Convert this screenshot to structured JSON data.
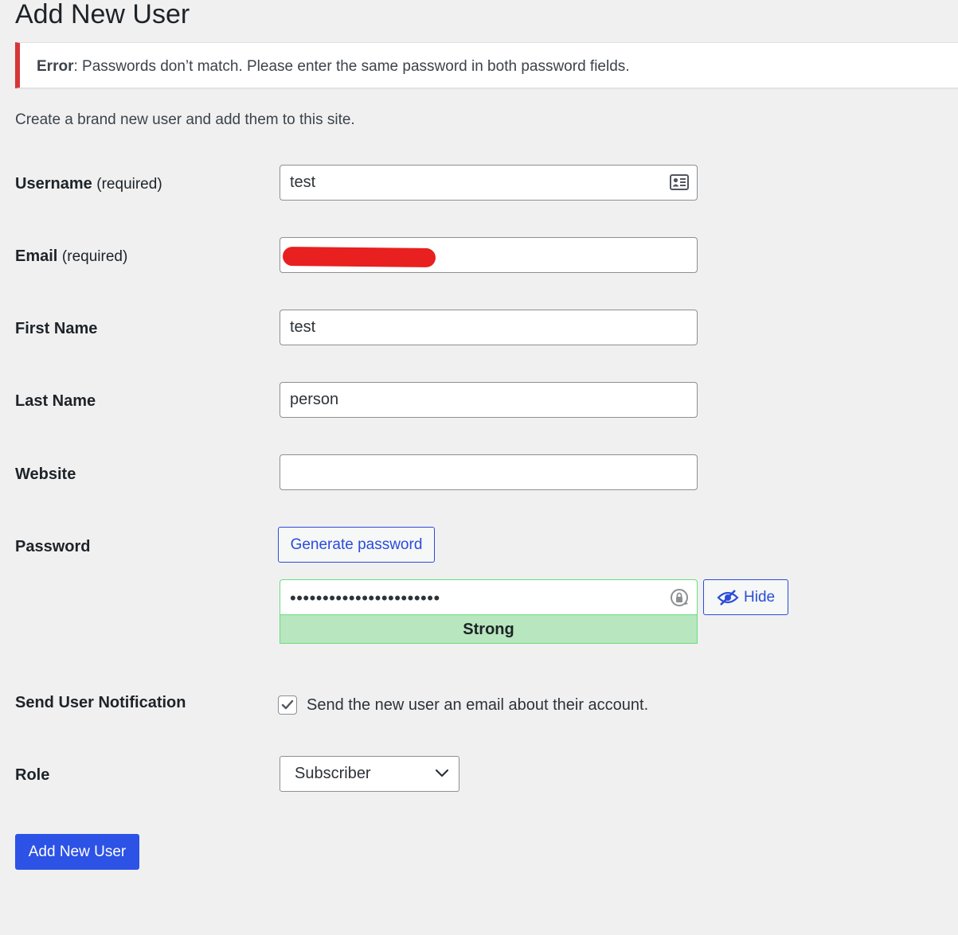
{
  "page": {
    "title": "Add New User",
    "intro": "Create a brand new user and add them to this site."
  },
  "notice": {
    "label": "Error",
    "message": ": Passwords don’t match. Please enter the same password in both password fields."
  },
  "fields": {
    "username": {
      "label": "Username",
      "required": "(required)",
      "value": "test"
    },
    "email": {
      "label": "Email",
      "required": "(required)",
      "value": ""
    },
    "first_name": {
      "label": "First Name",
      "value": "test"
    },
    "last_name": {
      "label": "Last Name",
      "value": "person"
    },
    "website": {
      "label": "Website",
      "value": ""
    },
    "password": {
      "label": "Password",
      "generate_label": "Generate password",
      "masked_value": "•••••••••••••••••••••••",
      "strength": "Strong",
      "hide_label": "Hide"
    },
    "notification": {
      "label": "Send User Notification",
      "checkbox_label": "Send the new user an email about their account.",
      "checked": true
    },
    "role": {
      "label": "Role",
      "selected": "Subscriber"
    }
  },
  "submit": {
    "label": "Add New User"
  },
  "colors": {
    "accent": "#2c52e6",
    "error": "#d63638",
    "strong_bg": "#b8e6bf",
    "strong_border": "#68de7c",
    "redaction": "#e82020"
  },
  "icons": {
    "username_field": "contact-card-icon",
    "password_field": "lock-icon",
    "hide_button": "eye-slash-icon",
    "role_select": "chevron-down-icon",
    "checkbox": "checkmark-icon"
  }
}
